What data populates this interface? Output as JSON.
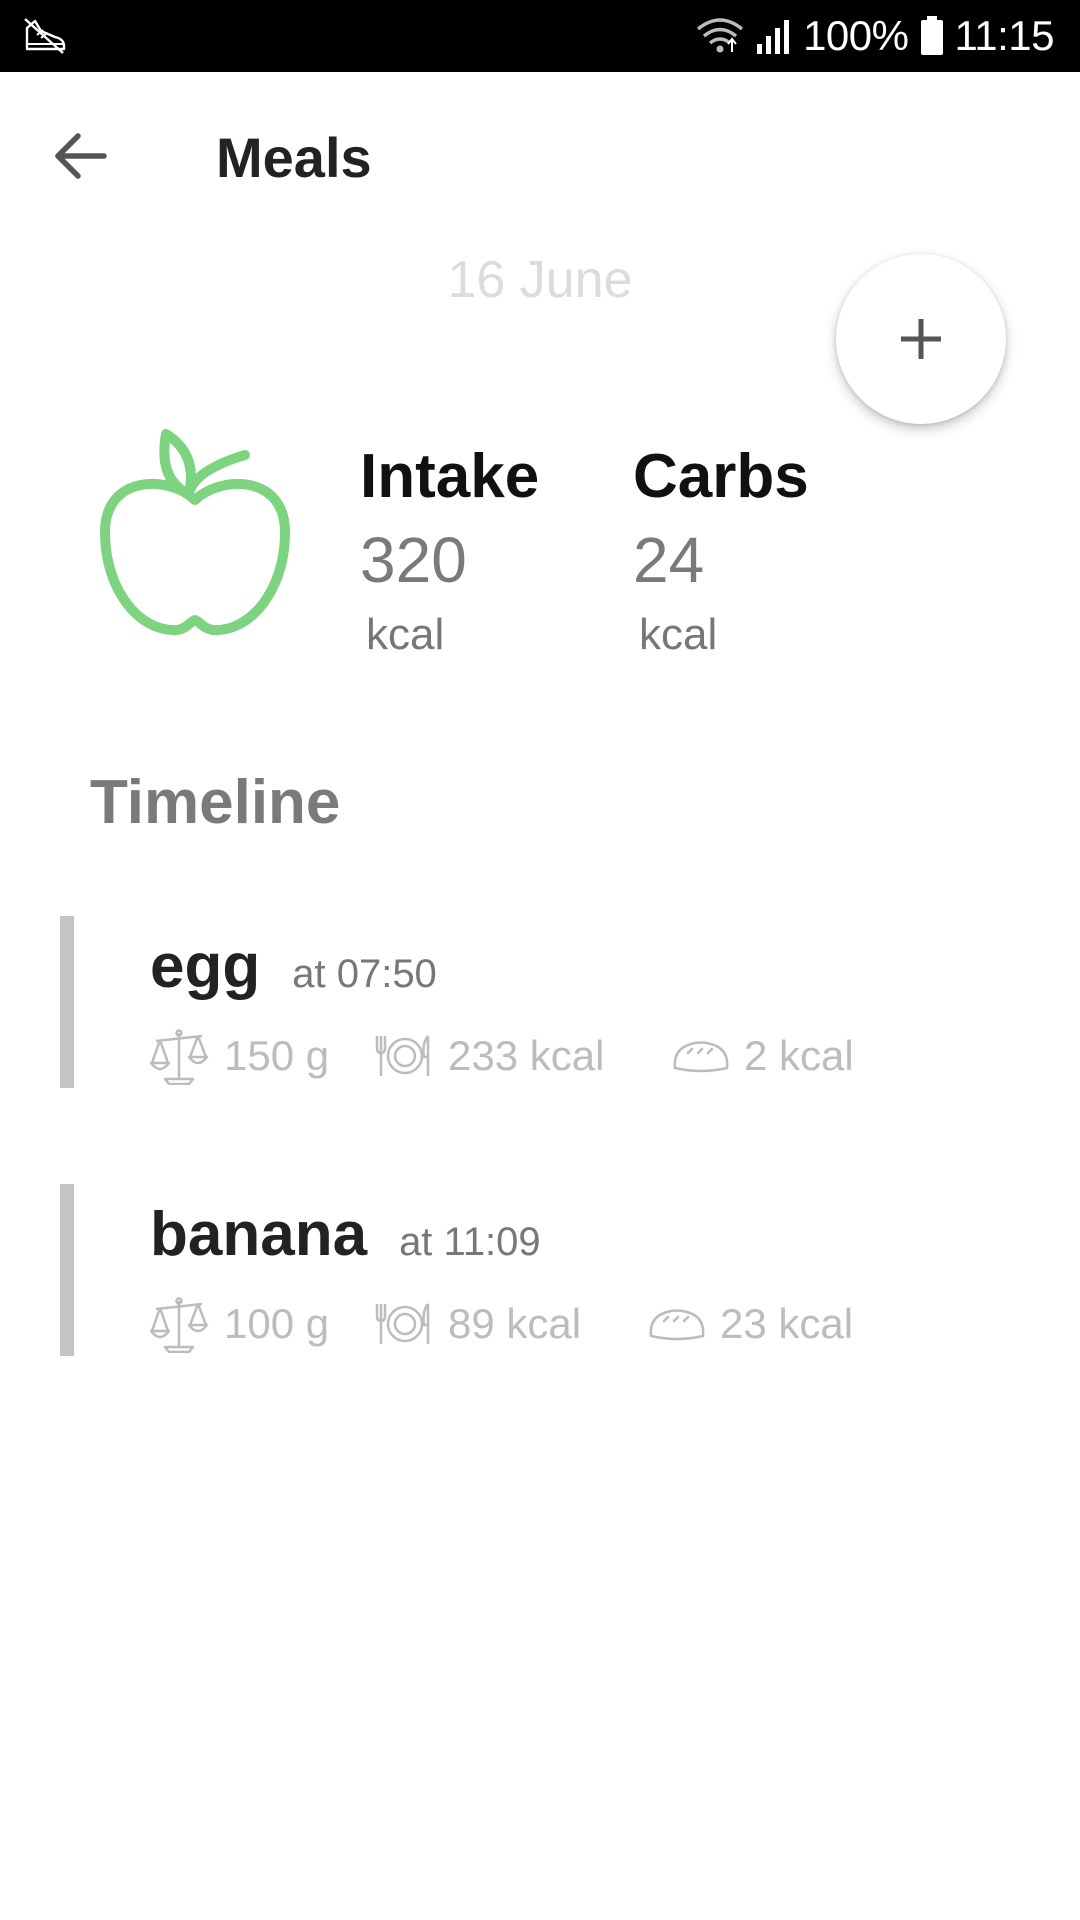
{
  "status_bar": {
    "battery_percent": "100%",
    "time": "11:15",
    "icons": [
      "shoe-icon",
      "wifi-icon",
      "signal-icon",
      "battery-icon"
    ]
  },
  "app_bar": {
    "title": "Meals",
    "back_icon": "arrow-left-icon"
  },
  "date": "16 June",
  "fab": {
    "icon": "plus-icon"
  },
  "colors": {
    "accent_green": "#7dd37f",
    "timeline_bar": "#c4c4c4",
    "muted_text": "#bcbcbc"
  },
  "summary": {
    "icon": "apple-icon",
    "intake": {
      "label": "Intake",
      "value": "320",
      "unit": "kcal"
    },
    "carbs": {
      "label": "Carbs",
      "value": "24",
      "unit": "kcal"
    }
  },
  "timeline": {
    "title": "Timeline",
    "meals": [
      {
        "name": "egg",
        "time": "at 07:50",
        "weight": "150 g",
        "calories": "233 kcal",
        "carbs": "2 kcal"
      },
      {
        "name": "banana",
        "time": "at 11:09",
        "weight": "100 g",
        "calories": "89 kcal",
        "carbs": "23 kcal"
      }
    ]
  }
}
